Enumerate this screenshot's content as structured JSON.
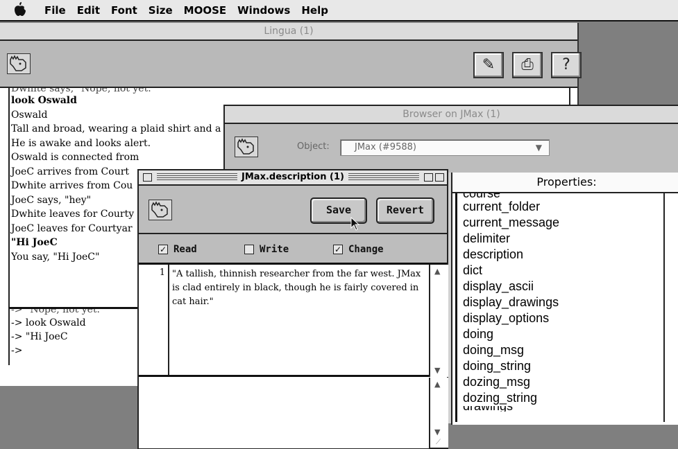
{
  "menubar": {
    "apple": "",
    "items": [
      "File",
      "Edit",
      "Font",
      "Size",
      "MOOSE",
      "Windows",
      "Help"
    ]
  },
  "lingua": {
    "title": "Lingua (1)",
    "transcript": [
      {
        "text": "look Oswald",
        "bold": true
      },
      {
        "text": "Oswald",
        "bold": false
      },
      {
        "text": "Tall and broad, wearing a plaid shirt and a",
        "bold": false
      },
      {
        "text": "He is awake and looks alert.",
        "bold": false
      },
      {
        "text": "Oswald is connected from",
        "bold": false
      },
      {
        "text": "JoeC arrives from Court",
        "bold": false
      },
      {
        "text": "Dwhite arrives from Cou",
        "bold": false
      },
      {
        "text": "JoeC says, \"hey\"",
        "bold": false
      },
      {
        "text": "Dwhite leaves for Courty",
        "bold": false
      },
      {
        "text": "JoeC leaves for Courtyar",
        "bold": false
      },
      {
        "text": "\"Hi JoeC",
        "bold": true
      },
      {
        "text": "You say, \"Hi JoeC\"",
        "bold": false
      }
    ],
    "transcript_top_cut": "Dwhite says, \"Nope, not yet.\"",
    "input_top_cut": "-> \"Nope, not yet.\"",
    "input_lines": [
      "-> look Oswald",
      "-> \"Hi JoeC",
      "->"
    ],
    "icons": [
      "moose-icon",
      "pencil-icon",
      "tray-icon",
      "help-icon"
    ],
    "help_glyph": "?"
  },
  "browser": {
    "title": "Browser on JMax (1)",
    "object_label": "Object:",
    "object_value": "JMax (#9588)",
    "properties_header": "Properties:",
    "properties_top_cut": "course",
    "properties": [
      "current_folder",
      "current_message",
      "delimiter",
      "description",
      "dict",
      "display_ascii",
      "display_drawings",
      "display_options",
      "doing",
      "doing_msg",
      "doing_string",
      "dozing_msg",
      "dozing_string"
    ],
    "properties_bottom_cut": "drawings"
  },
  "description": {
    "title": "JMax.description (1)",
    "save_label": "Save",
    "revert_label": "Revert",
    "permissions": [
      {
        "label": "Read",
        "checked": true
      },
      {
        "label": "Write",
        "checked": false
      },
      {
        "label": "Change",
        "checked": true
      }
    ],
    "line_number": "1",
    "text": "\"A tallish, thinnish researcher from the far west. JMax is clad entirely in black, though he is fairly covered in cat hair.\""
  }
}
